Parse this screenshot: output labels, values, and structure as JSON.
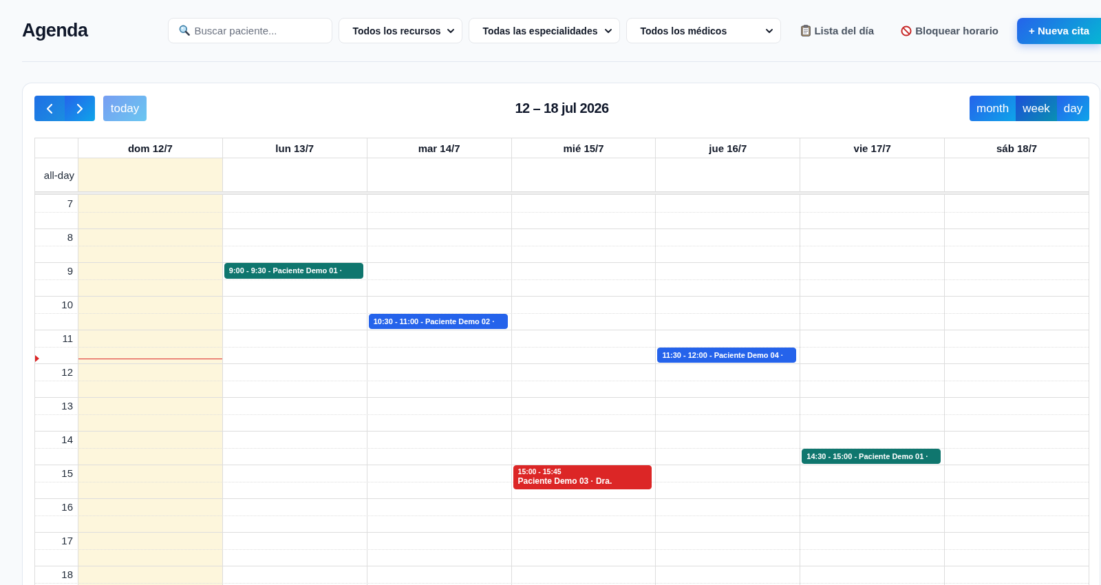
{
  "header": {
    "title": "Agenda",
    "search": {
      "placeholder": "Buscar paciente..."
    },
    "filters": [
      {
        "value": "Todos los recursos"
      },
      {
        "value": "Todas las especialidades"
      },
      {
        "value": "Todos los médicos"
      }
    ],
    "day_list_button": {
      "label": "Lista del día"
    },
    "block_button": {
      "label": "Bloquear horario"
    },
    "new_button": {
      "label": "+ Nueva cita"
    }
  },
  "calendar": {
    "toolbar": {
      "today_button": {
        "label": "today",
        "disabled": true
      },
      "title": "12 – 18 jul 2026",
      "views": [
        {
          "label": "month",
          "selected": false
        },
        {
          "label": "week",
          "selected": true
        },
        {
          "label": "day",
          "selected": false
        }
      ]
    },
    "all_day_label": "all-day",
    "hours": [
      "7",
      "8",
      "9",
      "10",
      "11",
      "12",
      "13",
      "14",
      "15",
      "16",
      "17",
      "18"
    ],
    "now_indicator": {
      "level": 0.58
    },
    "days": [
      {
        "label": "dom 12/7",
        "today": true
      },
      {
        "label": "lun 13/7",
        "today": false,
        "events": [
          {
            "kind": "compact",
            "color": "#0f766e",
            "text": "9:00 - 9:30 - Paciente Demo 01 ·"
          }
        ]
      },
      {
        "label": "mar 14/7",
        "today": false,
        "events": [
          {
            "kind": "compact",
            "color": "#2563eb",
            "text": "10:30 - 11:00 - Paciente Demo 02 ·"
          }
        ]
      },
      {
        "label": "mié 15/7",
        "today": false,
        "events": [
          {
            "kind": "block",
            "color": "#dc2626",
            "time": "15:00 - 15:45",
            "title": "Paciente Demo 03 · Dra."
          }
        ]
      },
      {
        "label": "jue 16/7",
        "today": false,
        "events": [
          {
            "kind": "compact",
            "color": "#2563eb",
            "text": "11:30 - 12:00 - Paciente Demo 04 ·"
          }
        ]
      },
      {
        "label": "vie 17/7",
        "today": false,
        "events": [
          {
            "kind": "compact",
            "color": "#0f766e",
            "text": "14:30 - 15:00 - Paciente Demo 01 ·"
          }
        ]
      },
      {
        "label": "sáb 18/7",
        "today": false
      }
    ]
  }
}
